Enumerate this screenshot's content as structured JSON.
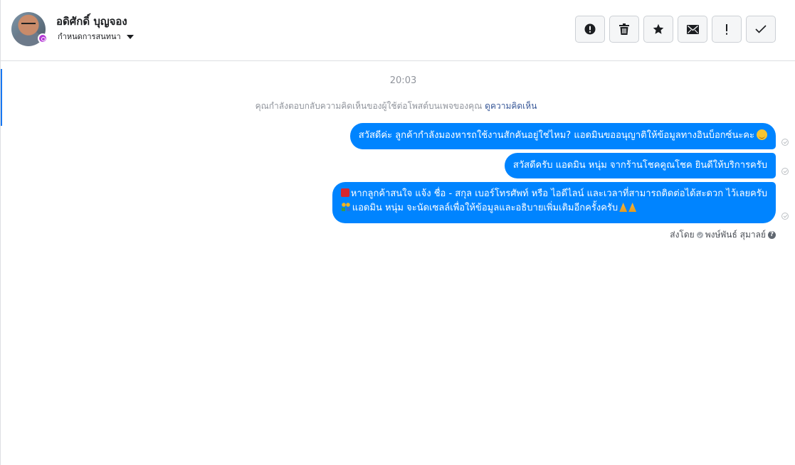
{
  "header": {
    "contact_name": "อดิศักดิ์ บุญจอง",
    "assign_label": "กำหนดการสนทนา",
    "actions": [
      {
        "id": "report",
        "icon": "alert-circle-icon"
      },
      {
        "id": "delete",
        "icon": "trash-icon"
      },
      {
        "id": "star",
        "icon": "star-icon"
      },
      {
        "id": "unread",
        "icon": "envelope-icon"
      },
      {
        "id": "important",
        "icon": "exclamation-icon",
        "label": "!"
      },
      {
        "id": "done",
        "icon": "check-icon"
      }
    ]
  },
  "conversation": {
    "timestamp": "20:03",
    "reply_note": "คุณกำลังตอบกลับความคิดเห็นของผู้ใช้ต่อโพสต์บนเพจของคุณ",
    "reply_link": "ดูความคิดเห็น",
    "messages": [
      {
        "lines": [
          "สวัสดีค่ะ ลูกค้ากำลังมองหารถใช้งานสักคันอยู่ใช่ไหม? แอดมินขออนุญาติให้ข้อมูลทางอินบ็อกซ์นะคะ"
        ],
        "emoji_end": "smile"
      },
      {
        "lines": [
          "สวัสดีครับ แอดมิน หนุ่ม จากร้านโชคคูณโชค ยินดีให้บริการครับ"
        ]
      },
      {
        "lines": [
          "หากลูกค้าสนใจ แจ้ง ชื่อ - สกุล เบอร์โทรศัพท์ หรือ ไอดีไลน์ และเวลาที่สามารถติดต่อได้สะดวก ไว้เลยครับ",
          "แอดมิน หนุ่ม จะนัดเซลล์เพื่อให้ข้อมูลและอธิบายเพิ่มเติมอีกครั้งครับ"
        ]
      }
    ],
    "sent_by_label": "ส่งโดย",
    "sent_by_name": "พงษ์พันธ์ สุมาลย์",
    "help_glyph": "?"
  },
  "colors": {
    "bubble": "#0084ff",
    "accent": "#1877f2",
    "link": "#385898"
  }
}
